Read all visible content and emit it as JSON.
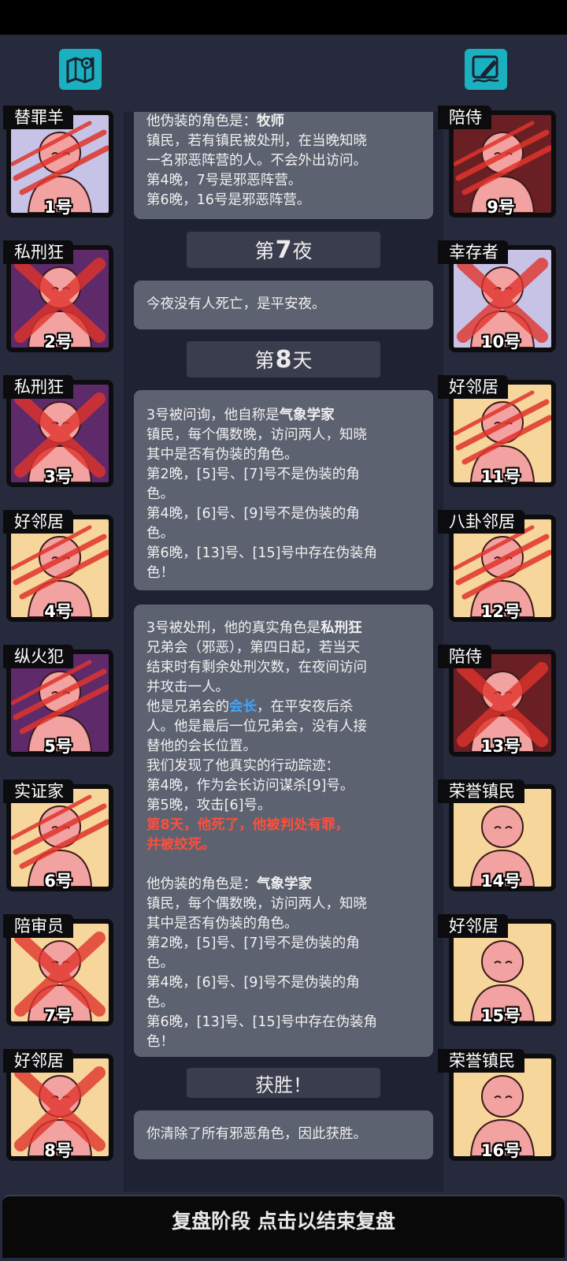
{
  "top_buttons": {
    "map": {
      "icon": "map-icon"
    },
    "notes": {
      "icon": "pen-icon"
    }
  },
  "players_left": [
    {
      "role": "替罪羊",
      "number": "1号",
      "bg": "#c6c3e6",
      "dead": true,
      "mark": "claw"
    },
    {
      "role": "私刑狂",
      "number": "2号",
      "bg": "#5e2a6a",
      "dead": true,
      "mark": "cross"
    },
    {
      "role": "私刑狂",
      "number": "3号",
      "bg": "#5e2a6a",
      "dead": true,
      "mark": "cross"
    },
    {
      "role": "好邻居",
      "number": "4号",
      "bg": "#f6d69a",
      "dead": true,
      "mark": "claw"
    },
    {
      "role": "纵火犯",
      "number": "5号",
      "bg": "#5e2a6a",
      "dead": true,
      "mark": "claw"
    },
    {
      "role": "实证家",
      "number": "6号",
      "bg": "#f6d69a",
      "dead": true,
      "mark": "claw"
    },
    {
      "role": "陪审员",
      "number": "7号",
      "bg": "#f6d69a",
      "dead": true,
      "mark": "cross"
    },
    {
      "role": "好邻居",
      "number": "8号",
      "bg": "#f6d69a",
      "dead": true,
      "mark": "cross"
    }
  ],
  "players_right": [
    {
      "role": "陪侍",
      "number": "9号",
      "bg": "#6a1f24",
      "dead": true,
      "mark": "claw"
    },
    {
      "role": "幸存者",
      "number": "10号",
      "bg": "#c6c3e6",
      "dead": true,
      "mark": "cross"
    },
    {
      "role": "好邻居",
      "number": "11号",
      "bg": "#f6d69a",
      "dead": true,
      "mark": "claw"
    },
    {
      "role": "八卦邻居",
      "number": "12号",
      "bg": "#f6d69a",
      "dead": true,
      "mark": "claw"
    },
    {
      "role": "陪侍",
      "number": "13号",
      "bg": "#6a1f24",
      "dead": true,
      "mark": "cross"
    },
    {
      "role": "荣誉镇民",
      "number": "14号",
      "bg": "#f6d69a",
      "dead": false,
      "mark": ""
    },
    {
      "role": "好邻居",
      "number": "15号",
      "bg": "#f6d69a",
      "dead": false,
      "mark": ""
    },
    {
      "role": "荣誉镇民",
      "number": "16号",
      "bg": "#f6d69a",
      "dead": false,
      "mark": ""
    }
  ],
  "log": {
    "msg1": {
      "l1_prefix": "他伪装的角色是：",
      "l1_role": "牧师",
      "l2": "镇民，若有镇民被处刑，在当晚知晓",
      "l3": "一名邪恶阵营的人。不会外出访问。",
      "l4": "第4晚，7号是邪恶阵营。",
      "l5": "第6晚，16号是邪恶阵营。"
    },
    "night7": {
      "pre": "第",
      "num": "7",
      "post": "夜"
    },
    "msg2": {
      "l1": "今夜没有人死亡，是平安夜。"
    },
    "day8": {
      "pre": "第",
      "num": "8",
      "post": "天"
    },
    "msg3": {
      "l1_prefix": "3号被问询，他自称是",
      "l1_role": "气象学家",
      "l2": "镇民，每个偶数晚，访问两人，知晓",
      "l3": "其中是否有伪装的角色。",
      "l4": "第2晚，[5]号、[7]号不是伪装的角",
      "l5": "色。",
      "l6": "第4晚，[6]号、[9]号不是伪装的角",
      "l7": "色。",
      "l8": "第6晚，[13]号、[15]号中存在伪装角",
      "l9": "色！"
    },
    "msg4": {
      "l1_prefix": "3号被处刑，他的真实角色是",
      "l1_role": "私刑狂",
      "l2": "兄弟会（邪恶），第四日起，若当天",
      "l3": "结束时有剩余处刑次数，在夜间访问",
      "l4": "并攻击一人。",
      "l5_prefix": "他是兄弟会的",
      "l5_hl": "会长",
      "l5_suffix": "，在平安夜后杀",
      "l6": "人。他是最后一位兄弟会，没有人接",
      "l7": "替他的会长位置。",
      "l8": "我们发现了他真实的行动踪迹：",
      "l9": "第4晚，作为会长访问谋杀[9]号。",
      "l10": "第5晚，攻击[6]号。",
      "l11": "第8天，他死了，他被判处有罪，",
      "l12": "并被绞死。",
      "l13_prefix": "他伪装的角色是：",
      "l13_role": "气象学家",
      "l14": "镇民，每个偶数晚，访问两人，知晓",
      "l15": "其中是否有伪装的角色。",
      "l16": "第2晚，[5]号、[7]号不是伪装的角",
      "l17": "色。",
      "l18": "第4晚，[6]号、[9]号不是伪装的角",
      "l19": "色。",
      "l20": "第6晚，[13]号、[15]号中存在伪装角",
      "l21": "色！"
    },
    "victory": "获胜！",
    "msg5": {
      "l1": "你清除了所有邪恶角色，因此获胜。"
    }
  },
  "bottom_bar": {
    "label": "复盘阶段 点击以结束复盘"
  }
}
